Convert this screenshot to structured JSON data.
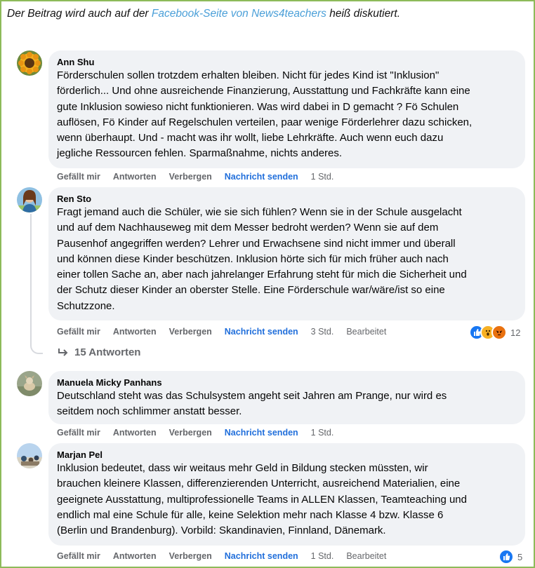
{
  "intro": {
    "before": "Der Beitrag wird auch auf der ",
    "link": "Facebook-Seite von News4teachers",
    "after": " heiß diskutiert."
  },
  "labels": {
    "like": "Gefällt mir",
    "reply": "Antworten",
    "hide": "Verbergen",
    "message": "Nachricht senden",
    "edited": "Bearbeitet"
  },
  "comments": [
    {
      "author": "Ann Shu",
      "lines": [
        "Förderschulen sollen trotzdem erhalten bleiben. Nicht für jedes Kind ist \"Inklusion\"",
        "förderlich... Und ohne ausreichende Finanzierung, Ausstattung und Fachkräfte kann eine",
        "gute Inklusion sowieso nicht funktionieren. Was wird dabei in D gemacht ? Fö Schulen",
        "auflösen, Fö Kinder auf Regelschulen verteilen, paar wenige Förderlehrer dazu schicken,",
        "wenn überhaupt. Und - macht was ihr wollt, liebe Lehrkräfte. Auch wenn euch dazu",
        "jegliche Ressourcen fehlen. Sparmaßnahme, nichts anderes."
      ],
      "time": "1 Std."
    },
    {
      "author": "Ren Sto",
      "lines": [
        "Fragt jemand auch die Schüler, wie sie sich fühlen? Wenn sie in der Schule ausgelacht",
        "und auf dem Nachhauseweg mit dem Messer bedroht werden? Wenn sie auf dem",
        "Pausenhof angegriffen werden? Lehrer und Erwachsene sind nicht immer und überall",
        "und können diese Kinder beschützen. Inklusion hörte sich für mich früher auch nach",
        "einer tollen Sache an, aber nach jahrelanger Erfahrung steht für mich die Sicherheit und",
        "der Schutz dieser Kinder an oberster Stelle. Eine Förderschule war/wäre/ist so eine",
        "Schutzzone."
      ],
      "time": "3 Std.",
      "reaction_count": "12",
      "reaction_icons": [
        "like-reaction-icon",
        "wow-reaction-icon",
        "angry-reaction-icon"
      ],
      "replies_label": "15 Antworten"
    },
    {
      "author": "Manuela Micky Panhans",
      "lines": [
        "Deutschland steht was das Schulsystem angeht seit Jahren am Prange, nur wird es",
        "seitdem noch schlimmer anstatt besser."
      ],
      "time": "1 Std."
    },
    {
      "author": "Marjan Pel",
      "lines": [
        "Inklusion bedeutet, dass wir weitaus mehr Geld in Bildung stecken müssten, wir",
        "brauchen kleinere Klassen, differenzierenden Unterricht, ausreichend Materialien, eine",
        "geeignete Ausstattung, multiprofessionelle Teams in ALLEN Klassen, Teamteaching und",
        "endlich mal eine Schule für alle, keine Selektion mehr nach Klasse 4 bzw. Klasse 6",
        "(Berlin und Brandenburg). Vorbild: Skandinavien, Finnland, Dänemark."
      ],
      "time": "1 Std.",
      "reaction_count": "5",
      "reaction_icons": [
        "like-reaction-icon"
      ]
    }
  ],
  "colors": {
    "frame_border": "#8dbb5a",
    "link": "#4a9fd8",
    "send_link": "#216fdb",
    "bubble_bg": "#f0f2f5",
    "like": "#1877f2",
    "wow": "#f7b125",
    "angry": "#e9710f"
  }
}
